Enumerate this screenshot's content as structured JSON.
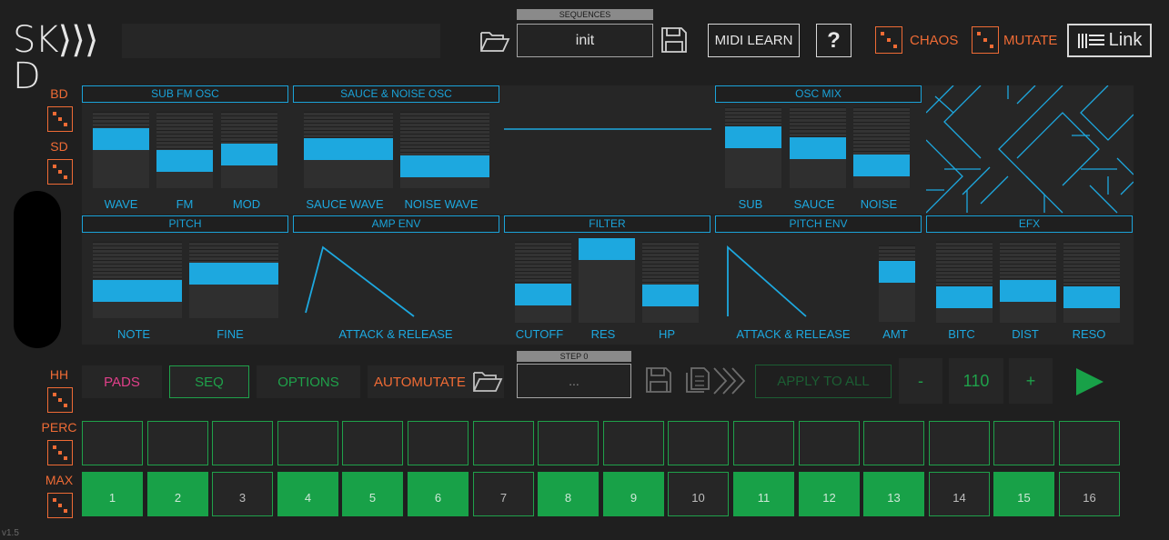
{
  "logo": {
    "text": "SK⟩⟩⟩D"
  },
  "header": {
    "sequences_label": "SEQUENCES",
    "sequence_name": "init",
    "midi_learn": "MIDI LEARN",
    "help": "?",
    "chaos": "CHAOS",
    "mutate": "MUTATE",
    "link": "Link"
  },
  "sidebar": {
    "bd": "BD",
    "sd": "SD",
    "hh": "HH",
    "perc": "PERC",
    "max": "MAX"
  },
  "sections": {
    "sub_fm_osc": "SUB FM OSC",
    "sauce_noise_osc": "SAUCE & NOISE OSC",
    "osc_mix": "OSC MIX",
    "pitch": "PITCH",
    "amp_env": "AMP ENV",
    "filter": "FILTER",
    "pitch_env": "PITCH ENV",
    "efx": "EFX"
  },
  "params": {
    "wave": {
      "label": "WAVE",
      "value": 0.7
    },
    "fm": {
      "label": "FM",
      "value": 0.3
    },
    "mod": {
      "label": "MOD",
      "value": 0.42
    },
    "sauce_wave": {
      "label": "SAUCE WAVE",
      "value": 0.52
    },
    "noise_wave": {
      "label": "NOISE WAVE",
      "value": 0.2
    },
    "sub": {
      "label": "SUB",
      "value": 0.68
    },
    "sauce": {
      "label": "SAUCE",
      "value": 0.5
    },
    "noise": {
      "label": "NOISE",
      "value": 0.2
    },
    "note": {
      "label": "NOTE",
      "value": 0.3
    },
    "fine": {
      "label": "FINE",
      "value": 0.62
    },
    "amp_attack_release": {
      "label": "ATTACK & RELEASE"
    },
    "cutoff": {
      "label": "CUTOFF",
      "value": 0.3
    },
    "res": {
      "label": "RES",
      "value": 1.0
    },
    "hp": {
      "label": "HP",
      "value": 0.28
    },
    "pitch_attack_release": {
      "label": "ATTACK & RELEASE"
    },
    "amt": {
      "label": "AMT",
      "value": 0.72
    },
    "bitc": {
      "label": "BITC",
      "value": 0.25
    },
    "dist": {
      "label": "DIST",
      "value": 0.35
    },
    "reso": {
      "label": "RESO",
      "value": 0.25
    }
  },
  "tabs": {
    "pads": "PADS",
    "seq": "SEQ",
    "options": "OPTIONS",
    "automutate": "AUTOMUTATE"
  },
  "step_label": "STEP 0",
  "step_field": "...",
  "apply_to_all": "APPLY TO ALL",
  "tempo": {
    "minus": "-",
    "value": "110",
    "plus": "+"
  },
  "steps": [
    {
      "n": "1",
      "on": true
    },
    {
      "n": "2",
      "on": true
    },
    {
      "n": "3",
      "on": false
    },
    {
      "n": "4",
      "on": true
    },
    {
      "n": "5",
      "on": true
    },
    {
      "n": "6",
      "on": true
    },
    {
      "n": "7",
      "on": false
    },
    {
      "n": "8",
      "on": true
    },
    {
      "n": "9",
      "on": true
    },
    {
      "n": "10",
      "on": false
    },
    {
      "n": "11",
      "on": true
    },
    {
      "n": "12",
      "on": true
    },
    {
      "n": "13",
      "on": true
    },
    {
      "n": "14",
      "on": false
    },
    {
      "n": "15",
      "on": true
    },
    {
      "n": "16",
      "on": false
    }
  ],
  "version": "v1.5",
  "colors": {
    "accent": "#1da8df",
    "orange": "#ef6b35",
    "green": "#18a148",
    "pink": "#e0408a"
  }
}
